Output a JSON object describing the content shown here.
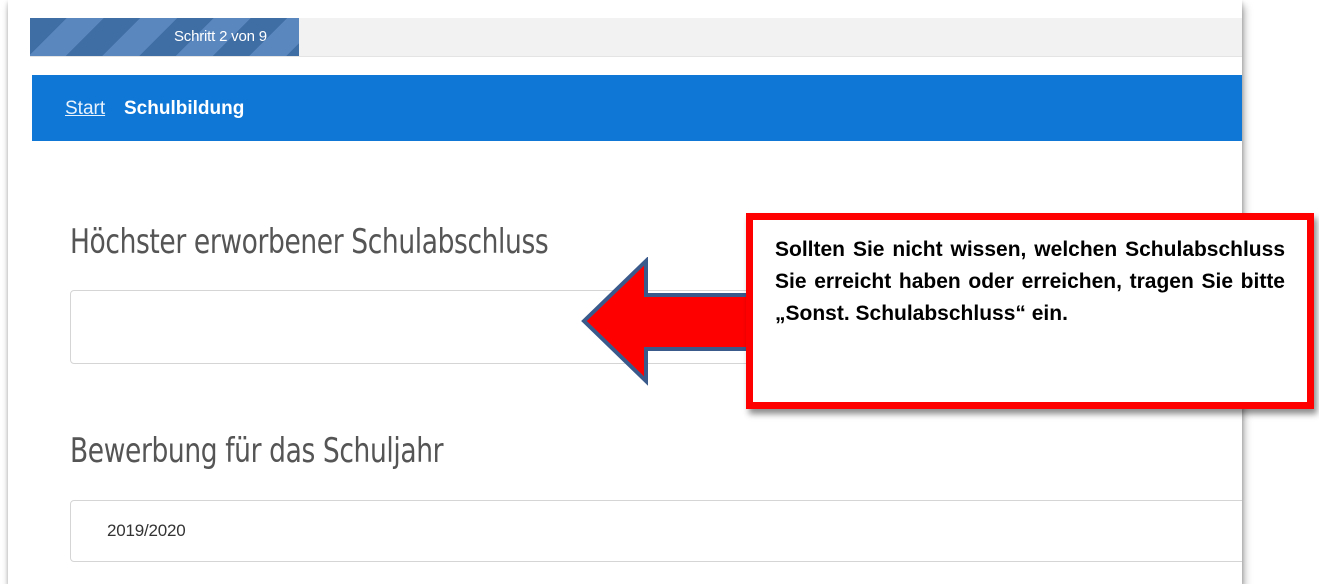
{
  "progress": {
    "label": "Schritt 2 von 9",
    "current_step": 2,
    "total_steps": 9
  },
  "breadcrumb": {
    "start": "Start",
    "current": "Schulbildung"
  },
  "form": {
    "school_degree": {
      "heading": "Höchster erworbener Schulabschluss",
      "value": ""
    },
    "school_year": {
      "heading": "Bewerbung für das Schuljahr",
      "value": "2019/2020"
    }
  },
  "callout": {
    "text": "Sollten Sie nicht wissen, welchen Schulabschluss Sie erreicht haben oder erreichen, tragen Sie bitte „Sonst. Schulabschluss“ ein."
  },
  "colors": {
    "nav_blue": "#0f78d7",
    "progress_blue": "#3f6ea5",
    "callout_border": "#ff0000",
    "arrow_fill": "#ff0000",
    "arrow_outline": "#3a5a8c"
  }
}
